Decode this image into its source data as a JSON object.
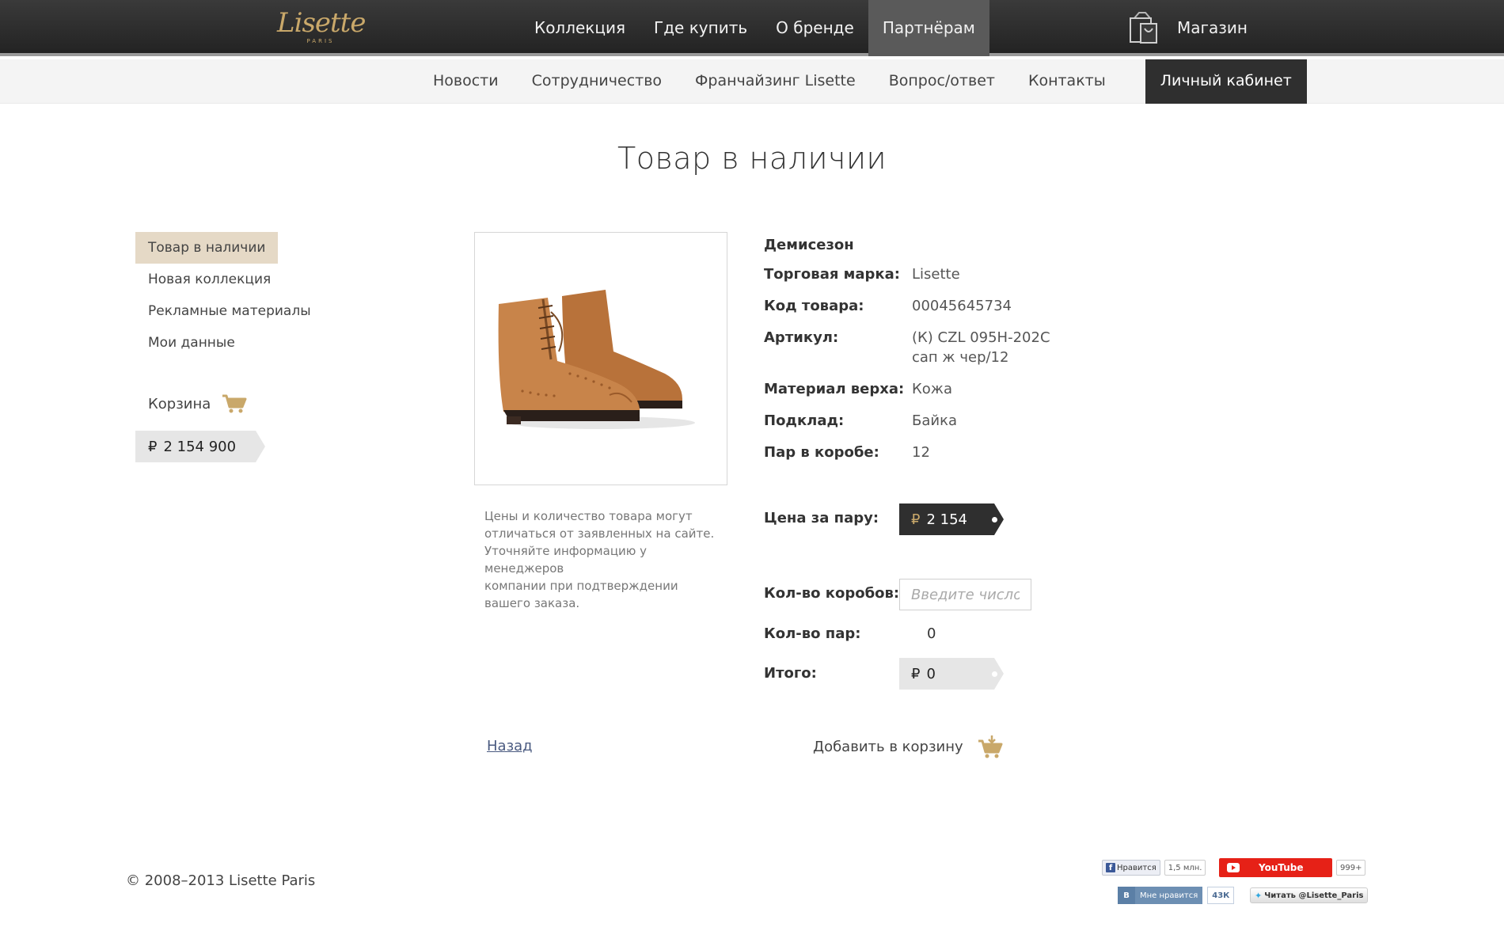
{
  "header": {
    "logo": {
      "main": "Lisette",
      "sub": "PARIS"
    },
    "nav": [
      "Коллекция",
      "Где купить",
      "О бренде",
      "Партнёрам"
    ],
    "active_nav": "Партнёрам",
    "shop_label": "Магазин",
    "shop_icon": "shopping-bag-icon"
  },
  "subnav": {
    "items": [
      "Новости",
      "Сотрудничество",
      "Франчайзинг Lisette",
      "Вопрос/ответ",
      "Контакты"
    ],
    "account": "Личный кабинет"
  },
  "page_title": "Товар в наличии",
  "sidebar": {
    "items": [
      "Товар в наличии",
      "Новая коллекция",
      "Рекламные материалы",
      "Мои данные"
    ],
    "active": "Товар в наличии",
    "cart_label": "Корзина",
    "cart_icon": "cart-icon",
    "cart_total": {
      "currency": "₽",
      "amount": "2 154 900"
    }
  },
  "product": {
    "image_icon": "ankle-boot-image",
    "note_lines": [
      "Цены и количество товара могут",
      "отличаться от заявленных на сайте.",
      "Уточняйте информацию у менеджеров",
      "компании при подтверждении",
      "вашего заказа."
    ],
    "season": "Демисезон",
    "attributes": {
      "brand_label": "Торговая марка:",
      "brand": "Lisette",
      "code_label": "Код товара:",
      "code": "00045645734",
      "article_label": "Артикул:",
      "article_lines": [
        "(К) CZL 095H-202C",
        "сап ж чер/12"
      ],
      "material_label": "Материал верха:",
      "material": "Кожа",
      "lining_label": "Подклад:",
      "lining": "Байка",
      "pairs_box_label": "Пар в коробе:",
      "pairs_box": "12"
    },
    "price_label": "Цена за пару:",
    "price": {
      "currency": "₽",
      "amount": "2 154"
    },
    "boxes_label": "Кол-во коробов:",
    "boxes_placeholder": "Введите число",
    "pairs_label": "Кол-во пар:",
    "pairs_value": "0",
    "total_label": "Итого:",
    "total": {
      "currency": "₽",
      "amount": "0"
    }
  },
  "actions": {
    "back": "Назад",
    "add_to_cart": "Добавить в корзину",
    "add_cart_icon": "add-to-cart-icon"
  },
  "footer": {
    "copyright": "© 2008–2013 Lisette Paris",
    "social": {
      "fb_like": "Нравится",
      "fb_count": "1,5 млн.",
      "youtube": "YouTube",
      "youtube_count": "999+",
      "vk_logo": "В",
      "vk_like": "Мне нравится",
      "vk_count": "43К",
      "twitter": "Читать @Lisette_Paris"
    }
  },
  "colors": {
    "accent": "#c9a86a",
    "active_side": "#e5d9c6",
    "dark": "#2f2f2f"
  }
}
